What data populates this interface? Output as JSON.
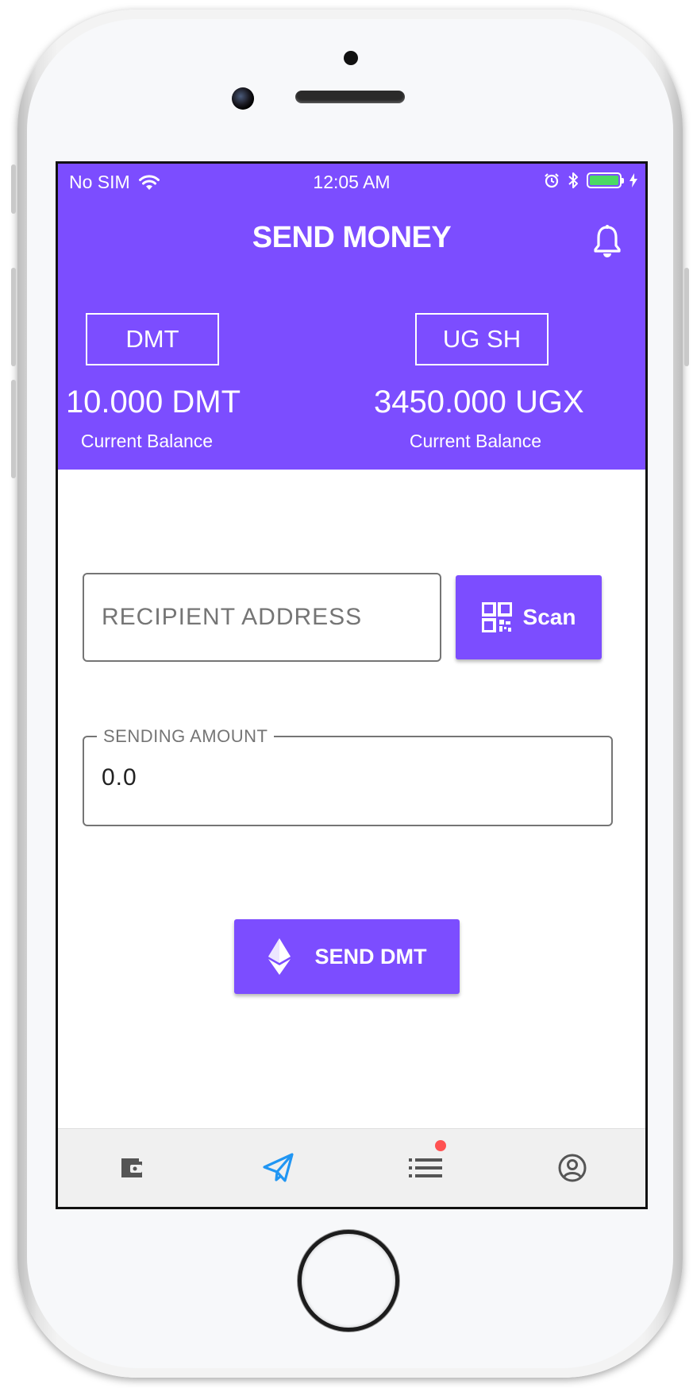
{
  "status_bar": {
    "carrier": "No SIM",
    "time": "12:05 AM"
  },
  "header": {
    "title": "SEND MONEY"
  },
  "balances": [
    {
      "currency_button": "DMT",
      "amount": "10.000 DMT",
      "label": "Current Balance"
    },
    {
      "currency_button": "UG SH",
      "amount": "3450.000 UGX",
      "label": "Current Balance"
    }
  ],
  "form": {
    "recipient_placeholder": "RECIPIENT ADDRESS",
    "scan_label": "Scan",
    "amount_label": "SENDING AMOUNT",
    "amount_value": "0.0",
    "send_label": "SEND DMT"
  },
  "bottom_nav": {
    "items": [
      {
        "icon": "wallet-icon",
        "active": false
      },
      {
        "icon": "send-icon",
        "active": true
      },
      {
        "icon": "list-icon",
        "active": false,
        "badge": true
      },
      {
        "icon": "account-icon",
        "active": false
      }
    ]
  },
  "colors": {
    "accent": "#7c4dff",
    "active_nav": "#2196f3",
    "badge": "#ff5252"
  }
}
